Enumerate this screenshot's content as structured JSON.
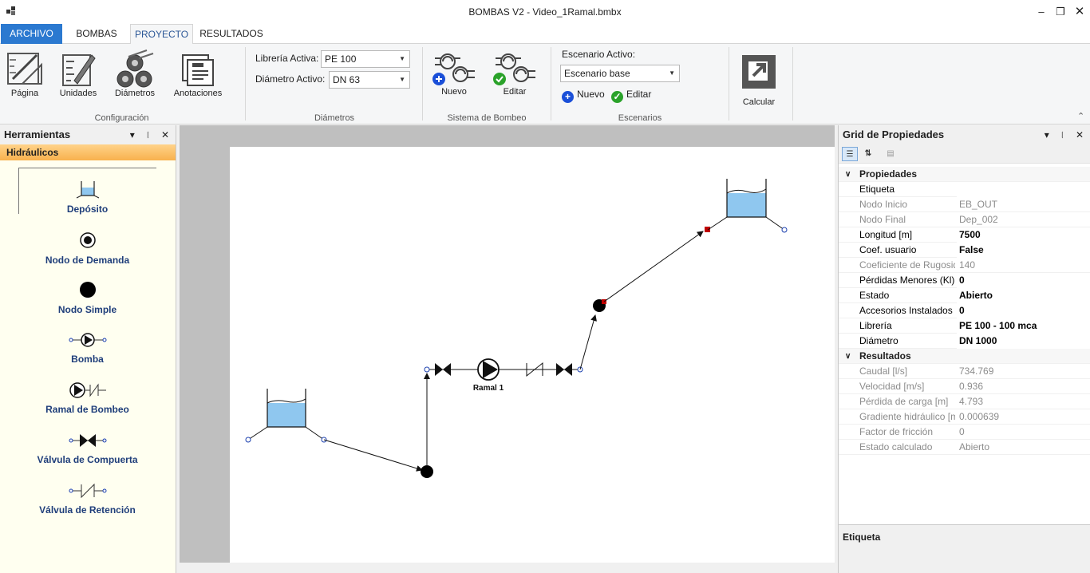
{
  "window": {
    "title": "BOMBAS V2 - Video_1Ramal.bmbx",
    "minimize_icon": "minimize-icon",
    "maximize_icon": "restore-icon",
    "close_icon": "close-icon"
  },
  "tabs": [
    {
      "label": "ARCHIVO"
    },
    {
      "label": "BOMBAS"
    },
    {
      "label": "PROYECTO"
    },
    {
      "label": "RESULTADOS"
    }
  ],
  "ribbon": {
    "config": {
      "group_label": "Configuración",
      "buttons": [
        {
          "label": "Página",
          "icon": "page-setup-icon"
        },
        {
          "label": "Unidades",
          "icon": "units-icon"
        },
        {
          "label": "Diámetros",
          "icon": "pipes-icon"
        },
        {
          "label": "Anotaciones",
          "icon": "annotations-icon"
        }
      ]
    },
    "diameters": {
      "group_label": "Diámetros",
      "library_label": "Librería Activa:",
      "library_value": "PE 100",
      "diameter_label": "Diámetro Activo:",
      "diameter_value": "DN 63"
    },
    "pump_system": {
      "group_label": "Sistema de Bombeo",
      "new_label": "Nuevo",
      "edit_label": "Editar"
    },
    "scenarios": {
      "group_label": "Escenarios",
      "active_label": "Escenario Activo:",
      "active_value": "Escenario base",
      "new_label": "Nuevo",
      "edit_label": "Editar"
    },
    "calc": {
      "label": "Calcular",
      "icon": "calculate-icon"
    }
  },
  "tools": {
    "title": "Herramientas",
    "category": "Hidráulicos",
    "items": [
      {
        "label": "Depósito",
        "icon": "tank-icon"
      },
      {
        "label": "Nodo de Demanda",
        "icon": "demand-node-icon"
      },
      {
        "label": "Nodo Simple",
        "icon": "simple-node-icon"
      },
      {
        "label": "Bomba",
        "icon": "pump-icon"
      },
      {
        "label": "Ramal de Bombeo",
        "icon": "pump-branch-icon"
      },
      {
        "label": "Válvula de Compuerta",
        "icon": "gate-valve-icon"
      },
      {
        "label": "Válvula de Retención",
        "icon": "check-valve-icon"
      }
    ]
  },
  "drawing": {
    "pump_label": "Ramal 1"
  },
  "props": {
    "title": "Grid de Propiedades",
    "sections": [
      {
        "name": "Propiedades",
        "rows": [
          {
            "name": "Etiqueta",
            "value": "",
            "editable": true
          },
          {
            "name": "Nodo Inicio",
            "value": "EB_OUT",
            "editable": false
          },
          {
            "name": "Nodo Final",
            "value": "Dep_002",
            "editable": false
          },
          {
            "name": "Longitud [m]",
            "value": "7500",
            "editable": true
          },
          {
            "name": "Coef. usuario",
            "value": "False",
            "editable": true
          },
          {
            "name": "Coeficiente de Rugosidad",
            "value": "140",
            "editable": false
          },
          {
            "name": "Pérdidas Menores (Kl)",
            "value": "0",
            "editable": true
          },
          {
            "name": "Estado",
            "value": "Abierto",
            "editable": true
          },
          {
            "name": "Accesorios Instalados",
            "value": "0",
            "editable": true
          },
          {
            "name": "Librería",
            "value": "PE 100 - 100 mca",
            "editable": true
          },
          {
            "name": "Diámetro",
            "value": "DN 1000",
            "editable": true
          }
        ]
      },
      {
        "name": "Resultados",
        "rows": [
          {
            "name": "Caudal [l/s]",
            "value": "734.769",
            "editable": false
          },
          {
            "name": "Velocidad [m/s]",
            "value": "0.936",
            "editable": false
          },
          {
            "name": "Pérdida de carga [m]",
            "value": "4.793",
            "editable": false
          },
          {
            "name": "Gradiente hidráulico [m/m]",
            "value": "0.000639",
            "editable": false
          },
          {
            "name": "Factor de fricción",
            "value": "0",
            "editable": false
          },
          {
            "name": "Estado calculado",
            "value": "Abierto",
            "editable": false
          }
        ]
      }
    ],
    "description_title": "Etiqueta"
  }
}
